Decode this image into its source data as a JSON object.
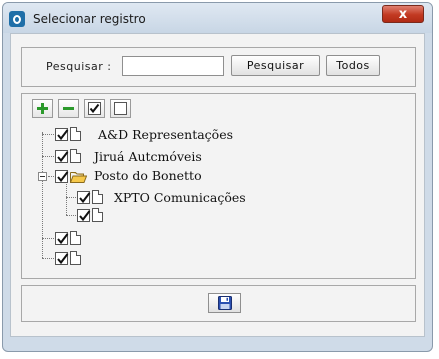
{
  "window": {
    "title": "Selecionar registro",
    "close_label": "x"
  },
  "search": {
    "label": "Pesquisar :",
    "value": "",
    "placeholder": "",
    "search_button": "Pesquisar",
    "all_button": "Todos"
  },
  "toolbar": {
    "icons": [
      "plus-icon",
      "minus-icon",
      "check-all-icon",
      "uncheck-all-icon"
    ]
  },
  "tree": {
    "nodes": [
      {
        "label": "A&D Representações",
        "checked": true,
        "icon": "document-icon"
      },
      {
        "label": "Jiruá Autcmóveis",
        "checked": true,
        "icon": "document-icon"
      },
      {
        "label": "Posto do Bonetto",
        "checked": true,
        "icon": "folder-open-icon",
        "expanded": true,
        "children": [
          {
            "label": "XPTO Comunicações",
            "checked": true,
            "icon": "document-icon"
          },
          {
            "label": "",
            "checked": true,
            "icon": "document-icon"
          }
        ]
      },
      {
        "label": "",
        "checked": true,
        "icon": "document-icon"
      },
      {
        "label": "",
        "checked": true,
        "icon": "document-icon"
      }
    ]
  },
  "footer": {
    "save_icon": "floppy-disk-icon"
  }
}
